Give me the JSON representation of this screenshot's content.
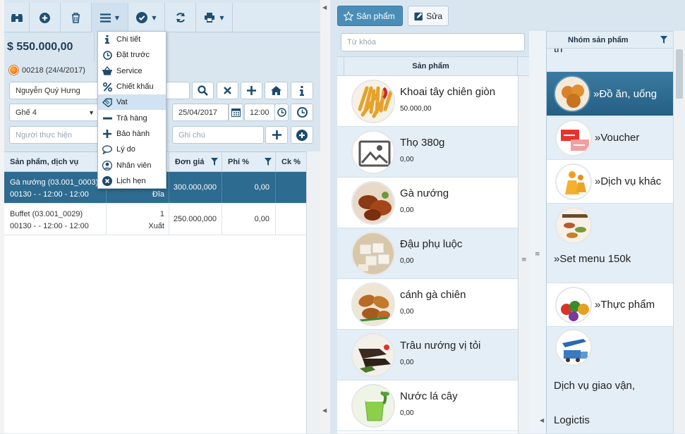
{
  "left": {
    "toolbar": {
      "buttons": [
        "binoculars-icon",
        "plus-circle-icon",
        "trash-icon",
        "menu-icon",
        "check-circle-icon",
        "refresh-icon",
        "print-icon"
      ]
    },
    "total": "$ 550.000,00",
    "order": {
      "label": "00218 (24/4/2017)"
    },
    "customer": {
      "value": "Nguyễn Quý Hưng"
    },
    "table": {
      "value": "Ghế 4"
    },
    "date": {
      "value": "25/04/2017"
    },
    "time": {
      "value": "12:00"
    },
    "performer": {
      "placeholder": "Người thực hiện"
    },
    "note": {
      "placeholder": "Ghi chú"
    },
    "grid": {
      "headers": [
        "Sản phẩm, dịch vụ",
        "Đơn giá",
        "Phí %",
        "Ck %"
      ],
      "rows": [
        {
          "name": "Gà nướng (03.001_0003)",
          "sub": "00130 - - 12:00 - 12:00",
          "qty": "",
          "unit": "Đĩa",
          "price": "300.000,000",
          "fee": "0,00"
        },
        {
          "name": "Buffet (03.001_0029)",
          "sub": "00130 - - 12:00 - 12:00",
          "qty": "1",
          "unit": "Xuất",
          "price": "250.000,000",
          "fee": "0,00"
        }
      ]
    },
    "menu": {
      "items": [
        {
          "label": "Chi tiết",
          "icon": "info-icon"
        },
        {
          "label": "Đặt trước",
          "icon": "clock-icon"
        },
        {
          "label": "Service",
          "icon": "basket-icon"
        },
        {
          "label": "Chiết khấu",
          "icon": "percent-icon"
        },
        {
          "label": "Vat",
          "icon": "tag-icon"
        },
        {
          "label": "Trả hàng",
          "icon": "minus-icon"
        },
        {
          "label": "Bảo hành",
          "icon": "plus-icon"
        },
        {
          "label": "Lý do",
          "icon": "comment-icon"
        },
        {
          "label": "Nhân viên",
          "icon": "user-icon"
        },
        {
          "label": "Lịch hẹn",
          "icon": "close-circle-icon"
        }
      ],
      "highlighted": "Vat"
    }
  },
  "right": {
    "tabs": {
      "products": "Sản phẩm",
      "edit": "Sửa"
    },
    "search": {
      "placeholder": "Từ khóa"
    },
    "products_header": "Sản phẩm",
    "products": [
      {
        "name": "Khoai tây chiên giòn",
        "price": "50.000,00",
        "thumb": "fries"
      },
      {
        "name": "Thọ 380g",
        "price": "0,00",
        "thumb": "placeholder"
      },
      {
        "name": "Gà nướng",
        "price": "0,00",
        "thumb": "chicken"
      },
      {
        "name": "Đậu phụ luộc",
        "price": "0,00",
        "thumb": "tofu"
      },
      {
        "name": "cánh gà chiên",
        "price": "0,00",
        "thumb": "wings"
      },
      {
        "name": "Trâu nướng vị tỏi",
        "price": "0,00",
        "thumb": "beef"
      },
      {
        "name": "Nước lá cây",
        "price": "0,00",
        "thumb": "drink"
      }
    ],
    "groups_header": "Nhóm sản phẩm",
    "groups": [
      {
        "label": "th",
        "partial": true
      },
      {
        "label": "»Đồ ăn, uống",
        "selected": true
      },
      {
        "label": "»Voucher"
      },
      {
        "label": "»Dịch vụ khác"
      },
      {
        "label": "»Set menu 150k"
      },
      {
        "label": "»Thực phẩm"
      },
      {
        "label": "Dịch vụ giao vận,"
      },
      {
        "label": "Logictis"
      }
    ]
  },
  "colors": {
    "accent": "#2e6b90",
    "toolbar_bg": "#dde9f3",
    "icon": "#1e4f73"
  }
}
